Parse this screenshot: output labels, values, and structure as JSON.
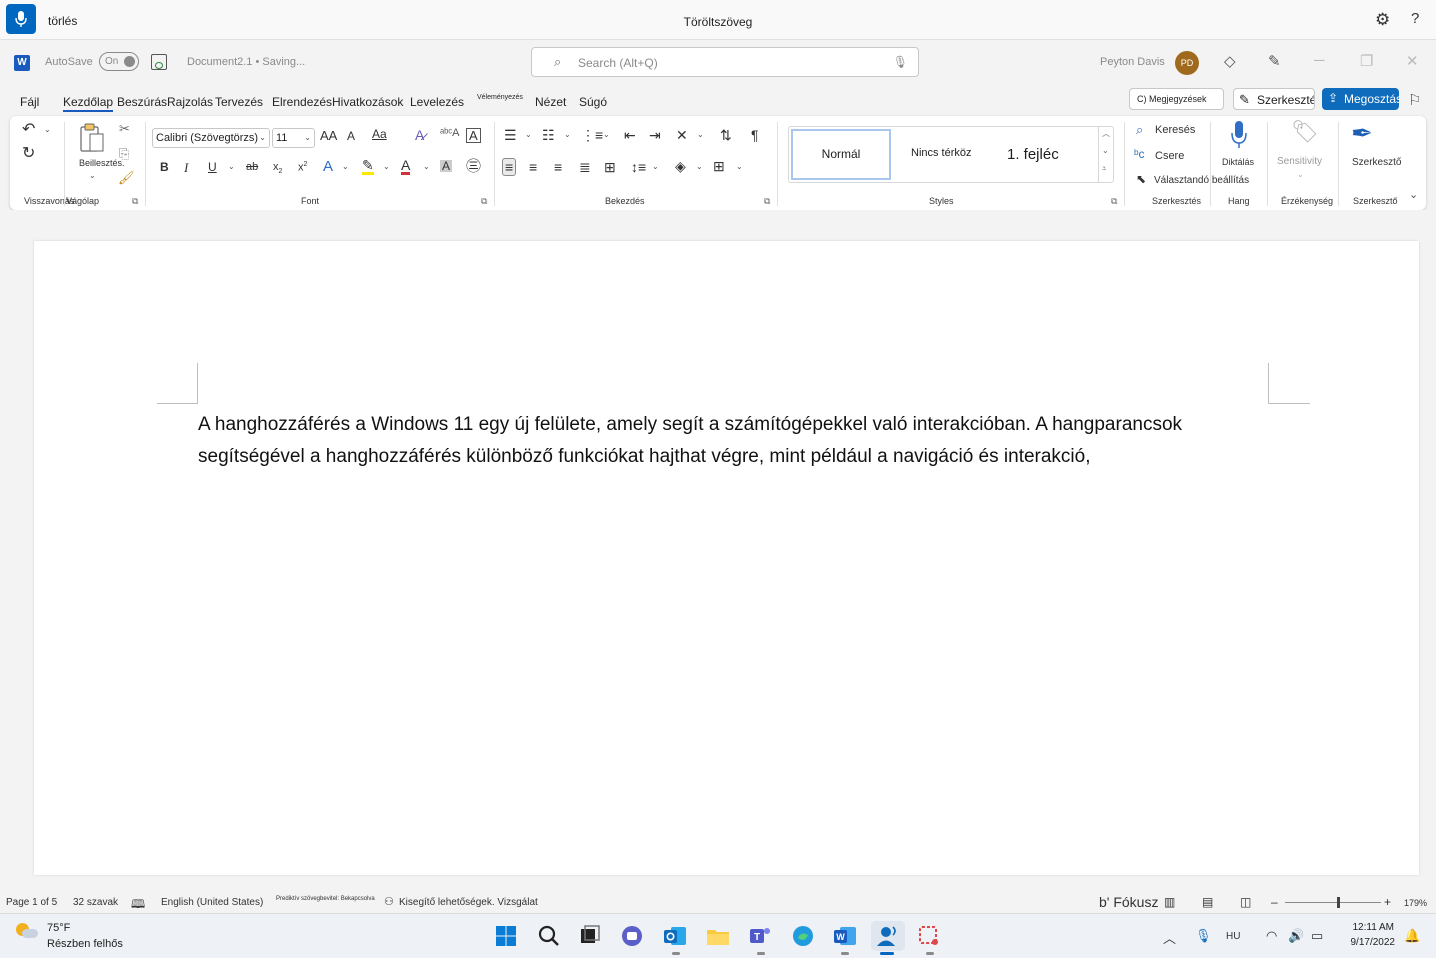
{
  "voice_access": {
    "command": "törlés",
    "status": "Töröltszöveg",
    "icons": [
      "microphone-icon",
      "gear-icon",
      "help-icon"
    ]
  },
  "titlebar": {
    "autosave_label": "AutoSave",
    "autosave_state": "On",
    "document_name": "Document2.1 • Saving...",
    "search_placeholder": "Search (Alt+Q)",
    "user_name": "Peyton Davis",
    "user_initials": "PD"
  },
  "tabs": [
    {
      "label": "Fájl"
    },
    {
      "label": "Kezdőlap",
      "active": true
    },
    {
      "label": "Beszúrás"
    },
    {
      "label": "Rajzolás"
    },
    {
      "label": "Tervezés"
    },
    {
      "label": "Elrendezés"
    },
    {
      "label": "Hivatkozások"
    },
    {
      "label": "Levelezés"
    },
    {
      "label": "Véleményezés"
    },
    {
      "label": "Nézet"
    },
    {
      "label": "Súgó"
    }
  ],
  "tab_actions": {
    "comments": "C) Megjegyzések",
    "editing": "Szerkesztés",
    "share": "Megosztás"
  },
  "ribbon": {
    "groups": {
      "undo": "Visszavonás",
      "clipboard": "Vágólap",
      "font": "Font",
      "paragraph": "Bekezdés",
      "styles": "Styles",
      "editing": "Szerkesztés",
      "voice": "Hang",
      "sensitivity": "Érzékenység",
      "editor": "Szerkesztő"
    },
    "paste_label": "Beillesztés.",
    "font_name": "Calibri (Szövegtörzs)",
    "font_size": "11",
    "font_size_buttons": [
      "AA",
      "A",
      "Aa"
    ],
    "format_buttons": [
      "B",
      "I",
      "U",
      "ab",
      "x",
      "x"
    ],
    "styles": [
      "Normál",
      "Nincs térköz",
      "1. fejléc"
    ],
    "find": "Keresés",
    "replace": "Csere",
    "select": "Választandó beállítás",
    "dictate": "Diktálás",
    "sensitivity": "Sensitivity",
    "editor": "Szerkesztő"
  },
  "document": {
    "body": "A hanghozzáférés a Windows 11 egy új felülete, amely segít a számítógépekkel való interakcióban. A hangparancsok segítségével a hanghozzáférés különböző funkciókat hajthat végre, mint például a navigáció és interakció,"
  },
  "statusbar": {
    "page": "Page 1 of 5",
    "words": "32 szavak",
    "language": "English (United States)",
    "predictions": "Prediktív szövegbevitel: Bekapcsolva",
    "accessibility": "Kisegítő lehetőségek. Vizsgálat",
    "focus": "b' Fókusz",
    "zoom": "179%",
    "zoom_level_percent": 55,
    "zoom_minus": "–",
    "zoom_plus": "+"
  },
  "taskbar": {
    "temperature": "75°F",
    "condition": "Részben felhős",
    "language": "HU",
    "time": "12:11 AM",
    "date": "9/17/2022",
    "apps": [
      "windows-start-icon",
      "search-icon",
      "task-view-icon",
      "chat-icon",
      "outlook-icon",
      "file-explorer-icon",
      "teams-icon",
      "edge-icon",
      "word-icon",
      "voice-access-icon",
      "snipping-tool-icon"
    ]
  },
  "colors": {
    "accent": "#0067c0",
    "word_blue": "#185abd",
    "share_button": "#0f6cbd",
    "avatar": "#a06a1e"
  }
}
